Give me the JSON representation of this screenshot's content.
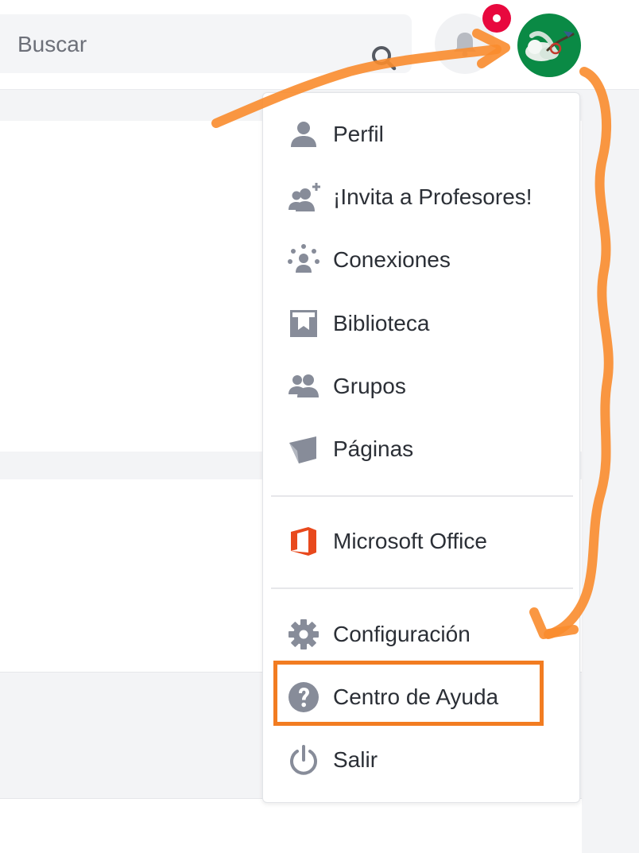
{
  "search": {
    "placeholder": "Buscar"
  },
  "header": {
    "notifications_badge_color": "#e8083e",
    "avatar_color": "#0a8a45"
  },
  "menu": {
    "items": [
      {
        "label": "Perfil",
        "icon": "person-icon"
      },
      {
        "label": "¡Invita a Profesores!",
        "icon": "invite-people-icon"
      },
      {
        "label": "Conexiones",
        "icon": "connections-icon"
      },
      {
        "label": "Biblioteca",
        "icon": "library-icon"
      },
      {
        "label": "Grupos",
        "icon": "groups-icon"
      },
      {
        "label": "Páginas",
        "icon": "pages-icon"
      }
    ],
    "office": {
      "label": "Microsoft Office",
      "icon": "microsoft-office-icon",
      "color": "#e8491d"
    },
    "settings": [
      {
        "label": "Configuración",
        "icon": "gear-icon"
      },
      {
        "label": "Centro de Ayuda",
        "icon": "help-circle-icon"
      },
      {
        "label": "Salir",
        "icon": "power-icon"
      }
    ]
  },
  "annotation": {
    "highlight_color": "#f27c21",
    "arrow_color": "#fa8c2e"
  }
}
